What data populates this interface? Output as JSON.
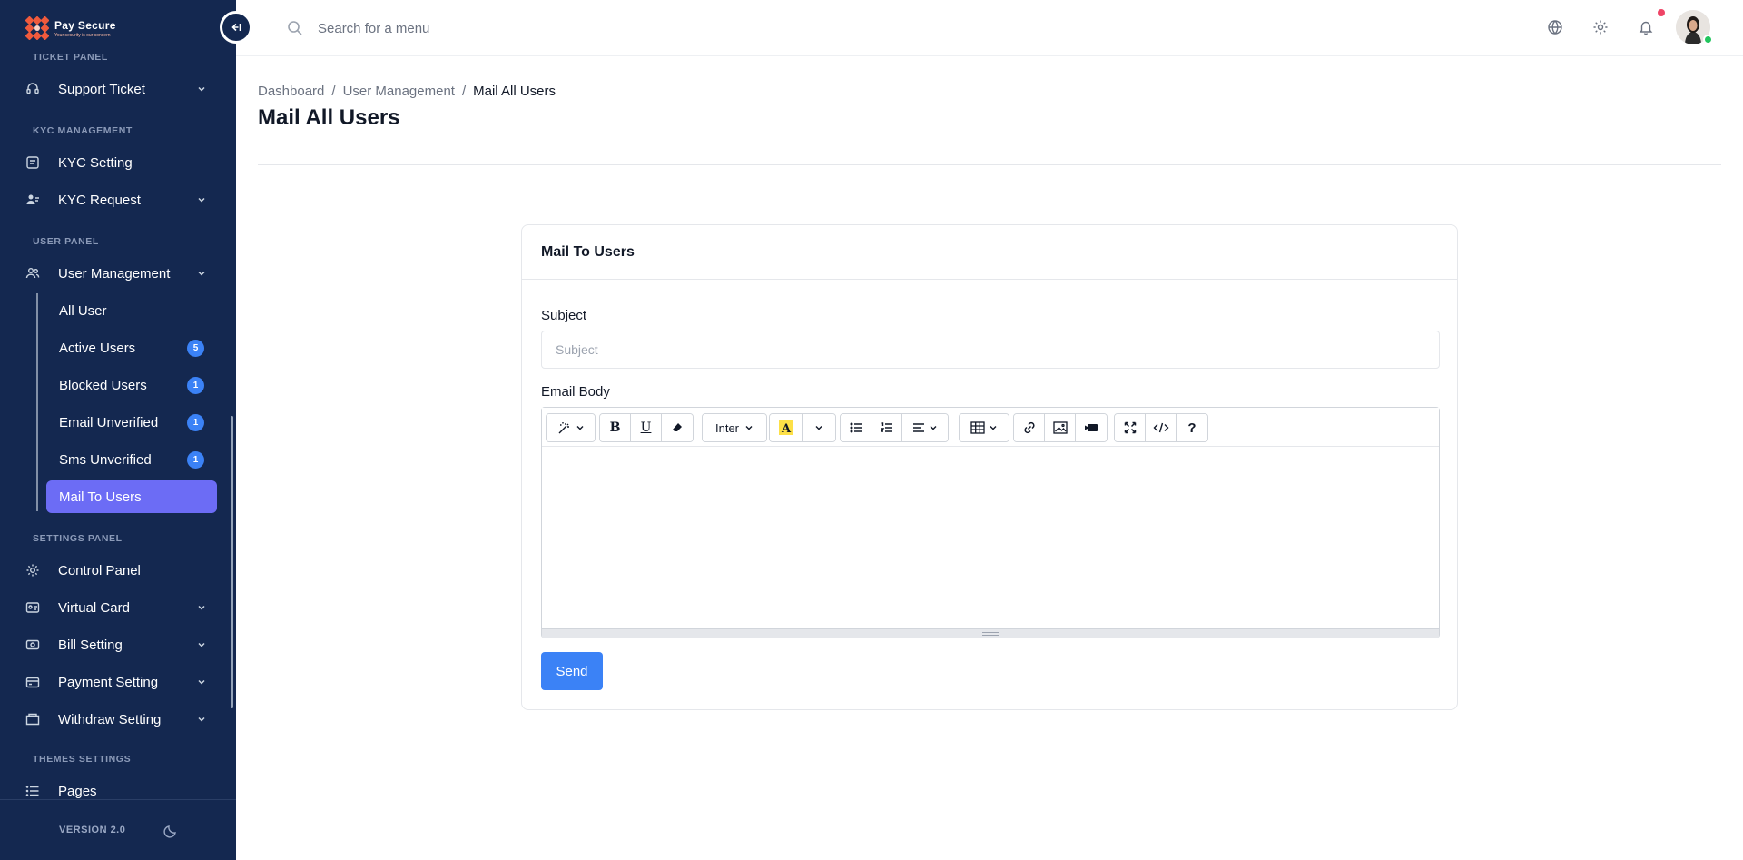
{
  "brand": {
    "name": "Pay Secure",
    "tagline": "Your security is our concern"
  },
  "sidebar": {
    "sections": [
      {
        "label": "TICKET PANEL"
      },
      {
        "label": "KYC MANAGEMENT"
      },
      {
        "label": "USER PANEL"
      },
      {
        "label": "SETTINGS PANEL"
      },
      {
        "label": "THEMES SETTINGS"
      }
    ],
    "items": [
      {
        "label": "Support Ticket",
        "icon": "headset-icon"
      },
      {
        "label": "KYC Setting",
        "icon": "id-card-icon"
      },
      {
        "label": "KYC Request",
        "icon": "users-check-icon"
      },
      {
        "label": "User Management",
        "icon": "users-icon"
      },
      {
        "label": "Control Panel",
        "icon": "gear-icon"
      },
      {
        "label": "Virtual Card",
        "icon": "card-icon"
      },
      {
        "label": "Bill Setting",
        "icon": "bill-icon"
      },
      {
        "label": "Payment Setting",
        "icon": "wallet-icon"
      },
      {
        "label": "Withdraw Setting",
        "icon": "folder-icon"
      },
      {
        "label": "Pages",
        "icon": "list-icon"
      }
    ],
    "sub_items": [
      {
        "label": "All User"
      },
      {
        "label": "Active Users",
        "badge": "5"
      },
      {
        "label": "Blocked Users",
        "badge": "1"
      },
      {
        "label": "Email Unverified",
        "badge": "1"
      },
      {
        "label": "Sms Unverified",
        "badge": "1"
      },
      {
        "label": "Mail To Users",
        "active": true
      }
    ],
    "version": "VERSION 2.0"
  },
  "topbar": {
    "search_placeholder": "Search for a menu"
  },
  "breadcrumb": [
    "Dashboard",
    "User Management",
    "Mail All Users"
  ],
  "page_title": "Mail All Users",
  "card": {
    "title": "Mail To Users",
    "subject_label": "Subject",
    "subject_placeholder": "Subject",
    "body_label": "Email Body",
    "font_name": "Inter",
    "send_label": "Send"
  },
  "colors": {
    "sidebar_bg": "#142850",
    "active_item": "#6c6cf5",
    "primary": "#3b82f6",
    "badge": "#3b82f6",
    "notification": "#ef4466",
    "online": "#22c55e"
  }
}
